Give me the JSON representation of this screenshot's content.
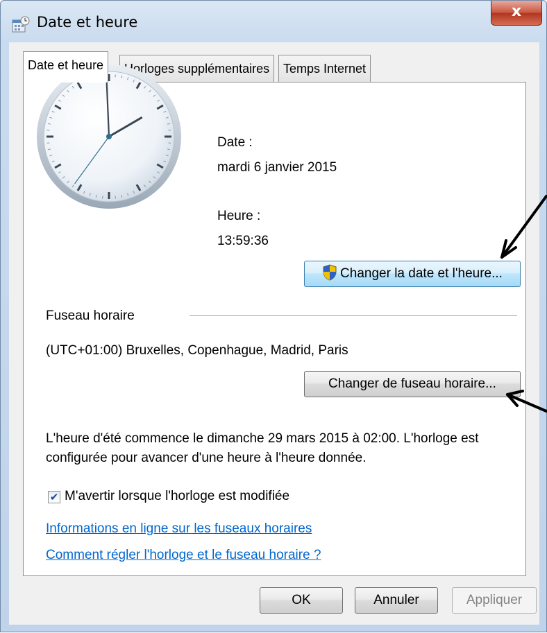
{
  "window": {
    "title": "Date et heure",
    "close_label": "x"
  },
  "tabs": [
    {
      "label": "Date et heure",
      "active": true
    },
    {
      "label": "Horloges supplémentaires",
      "active": false
    },
    {
      "label": "Temps Internet",
      "active": false
    }
  ],
  "datetime": {
    "date_label": "Date :",
    "date_value": "mardi 6 janvier 2015",
    "time_label": "Heure :",
    "time_value": "13:59:36",
    "change_button": "Changer la date et l'heure..."
  },
  "clock": {
    "hour": 13,
    "minute": 59,
    "second": 36
  },
  "timezone": {
    "section_label": "Fuseau horaire",
    "value": "(UTC+01:00) Bruxelles, Copenhague, Madrid, Paris",
    "change_button": "Changer de fuseau horaire..."
  },
  "dst": {
    "line1": "L'heure d'été commence le dimanche 29 mars 2015 à 02:00. L'horloge est",
    "line2": "configurée pour avancer d'une heure à l'heure donnée."
  },
  "notify": {
    "checked": true,
    "label": "M'avertir lorsque l'horloge est modifiée"
  },
  "links": [
    "Informations en ligne sur les fuseaux horaires",
    "Comment régler l'horloge et le fuseau horaire ?"
  ],
  "footer": {
    "ok": "OK",
    "cancel": "Annuler",
    "apply": "Appliquer"
  },
  "colors": {
    "link": "#0066cc",
    "close_button": "#c8553f",
    "primary_button_border": "#3c7fb1"
  }
}
